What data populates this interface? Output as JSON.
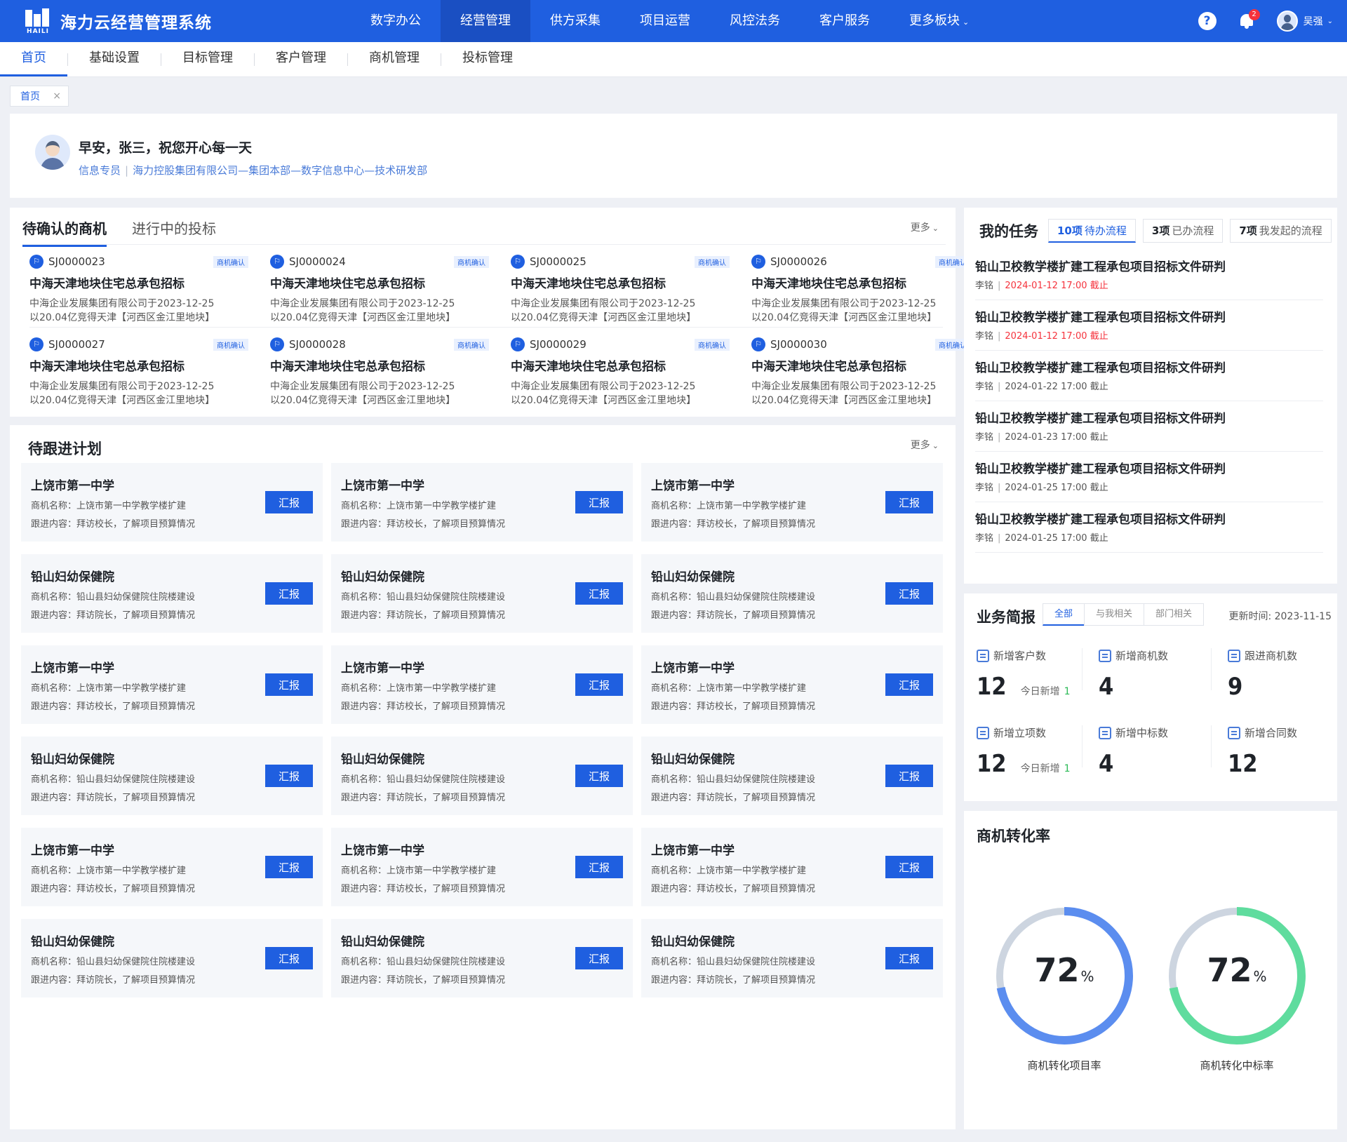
{
  "header": {
    "logo_text": "HAILI",
    "app_title": "海力云经营管理系统",
    "nav": [
      "数字办公",
      "经营管理",
      "供方采集",
      "项目运营",
      "风控法务",
      "客户服务",
      "更多板块"
    ],
    "nav_active": 1,
    "help_icon": "?",
    "notification_count": "2",
    "user_name": "吴强"
  },
  "subnav": {
    "items": [
      "首页",
      "基础设置",
      "目标管理",
      "客户管理",
      "商机管理",
      "投标管理"
    ],
    "active": 0
  },
  "page_tab": {
    "label": "首页",
    "close": "×"
  },
  "welcome": {
    "greeting": "早安，张三，祝您开心每一天",
    "role": "信息专员",
    "separator": "|",
    "org": "海力控股集团有限公司—集团本部—数字信息中心—技术研发部"
  },
  "opportunities": {
    "tabs": [
      "待确认的商机",
      "进行中的投标"
    ],
    "more": "更多",
    "items": [
      {
        "code": "SJ0000023",
        "badge": "商机确认",
        "title": "中海天津地块住宅总承包招标",
        "desc1": "中海企业发展集团有限公司于2023-12-25",
        "desc2": "以20.04亿竞得天津【河西区金江里地块】"
      },
      {
        "code": "SJ0000024",
        "badge": "商机确认",
        "title": "中海天津地块住宅总承包招标",
        "desc1": "中海企业发展集团有限公司于2023-12-25",
        "desc2": "以20.04亿竞得天津【河西区金江里地块】"
      },
      {
        "code": "SJ0000025",
        "badge": "商机确认",
        "title": "中海天津地块住宅总承包招标",
        "desc1": "中海企业发展集团有限公司于2023-12-25",
        "desc2": "以20.04亿竞得天津【河西区金江里地块】"
      },
      {
        "code": "SJ0000026",
        "badge": "商机确认",
        "title": "中海天津地块住宅总承包招标",
        "desc1": "中海企业发展集团有限公司于2023-12-25",
        "desc2": "以20.04亿竞得天津【河西区金江里地块】"
      },
      {
        "code": "SJ0000027",
        "badge": "商机确认",
        "title": "中海天津地块住宅总承包招标",
        "desc1": "中海企业发展集团有限公司于2023-12-25",
        "desc2": "以20.04亿竞得天津【河西区金江里地块】"
      },
      {
        "code": "SJ0000028",
        "badge": "商机确认",
        "title": "中海天津地块住宅总承包招标",
        "desc1": "中海企业发展集团有限公司于2023-12-25",
        "desc2": "以20.04亿竞得天津【河西区金江里地块】"
      },
      {
        "code": "SJ0000029",
        "badge": "商机确认",
        "title": "中海天津地块住宅总承包招标",
        "desc1": "中海企业发展集团有限公司于2023-12-25",
        "desc2": "以20.04亿竞得天津【河西区金江里地块】"
      },
      {
        "code": "SJ0000030",
        "badge": "商机确认",
        "title": "中海天津地块住宅总承包招标",
        "desc1": "中海企业发展集团有限公司于2023-12-25",
        "desc2": "以20.04亿竞得天津【河西区金江里地块】"
      }
    ]
  },
  "plans": {
    "title": "待跟进计划",
    "more": "更多",
    "button_label": "汇报",
    "items": [
      {
        "name": "上饶市第一中学",
        "opp": "商机名称：上饶市第一中学教学楼扩建",
        "content": "跟进内容：拜访校长，了解项目预算情况"
      },
      {
        "name": "上饶市第一中学",
        "opp": "商机名称：上饶市第一中学教学楼扩建",
        "content": "跟进内容：拜访校长，了解项目预算情况"
      },
      {
        "name": "上饶市第一中学",
        "opp": "商机名称：上饶市第一中学教学楼扩建",
        "content": "跟进内容：拜访校长，了解项目预算情况"
      },
      {
        "name": "铅山妇幼保健院",
        "opp": "商机名称：铅山县妇幼保健院住院楼建设",
        "content": "跟进内容：拜访院长，了解项目预算情况"
      },
      {
        "name": "铅山妇幼保健院",
        "opp": "商机名称：铅山县妇幼保健院住院楼建设",
        "content": "跟进内容：拜访院长，了解项目预算情况"
      },
      {
        "name": "铅山妇幼保健院",
        "opp": "商机名称：铅山县妇幼保健院住院楼建设",
        "content": "跟进内容：拜访院长，了解项目预算情况"
      },
      {
        "name": "上饶市第一中学",
        "opp": "商机名称：上饶市第一中学教学楼扩建",
        "content": "跟进内容：拜访校长，了解项目预算情况"
      },
      {
        "name": "上饶市第一中学",
        "opp": "商机名称：上饶市第一中学教学楼扩建",
        "content": "跟进内容：拜访校长，了解项目预算情况"
      },
      {
        "name": "上饶市第一中学",
        "opp": "商机名称：上饶市第一中学教学楼扩建",
        "content": "跟进内容：拜访校长，了解项目预算情况"
      },
      {
        "name": "铅山妇幼保健院",
        "opp": "商机名称：铅山县妇幼保健院住院楼建设",
        "content": "跟进内容：拜访院长，了解项目预算情况"
      },
      {
        "name": "铅山妇幼保健院",
        "opp": "商机名称：铅山县妇幼保健院住院楼建设",
        "content": "跟进内容：拜访院长，了解项目预算情况"
      },
      {
        "name": "铅山妇幼保健院",
        "opp": "商机名称：铅山县妇幼保健院住院楼建设",
        "content": "跟进内容：拜访院长，了解项目预算情况"
      },
      {
        "name": "上饶市第一中学",
        "opp": "商机名称：上饶市第一中学教学楼扩建",
        "content": "跟进内容：拜访校长，了解项目预算情况"
      },
      {
        "name": "上饶市第一中学",
        "opp": "商机名称：上饶市第一中学教学楼扩建",
        "content": "跟进内容：拜访校长，了解项目预算情况"
      },
      {
        "name": "上饶市第一中学",
        "opp": "商机名称：上饶市第一中学教学楼扩建",
        "content": "跟进内容：拜访校长，了解项目预算情况"
      },
      {
        "name": "铅山妇幼保健院",
        "opp": "商机名称：铅山县妇幼保健院住院楼建设",
        "content": "跟进内容：拜访院长，了解项目预算情况"
      },
      {
        "name": "铅山妇幼保健院",
        "opp": "商机名称：铅山县妇幼保健院住院楼建设",
        "content": "跟进内容：拜访院长，了解项目预算情况"
      },
      {
        "name": "铅山妇幼保健院",
        "opp": "商机名称：铅山县妇幼保健院住院楼建设",
        "content": "跟进内容：拜访院长，了解项目预算情况"
      }
    ]
  },
  "tasks": {
    "title": "我的任务",
    "tabs": [
      {
        "count": "10项",
        "label": "待办流程"
      },
      {
        "count": "3项",
        "label": "已办流程"
      },
      {
        "count": "7项",
        "label": "我发起的流程"
      }
    ],
    "items": [
      {
        "name": "铅山卫校教学楼扩建工程承包项目招标文件研判",
        "person": "李铭",
        "date": "2024-01-12  17:00",
        "suffix": "截止",
        "overdue": true
      },
      {
        "name": "铅山卫校教学楼扩建工程承包项目招标文件研判",
        "person": "李铭",
        "date": "2024-01-12  17:00",
        "suffix": "截止",
        "overdue": true
      },
      {
        "name": "铅山卫校教学楼扩建工程承包项目招标文件研判",
        "person": "李铭",
        "date": "2024-01-22  17:00",
        "suffix": "截止",
        "overdue": false
      },
      {
        "name": "铅山卫校教学楼扩建工程承包项目招标文件研判",
        "person": "李铭",
        "date": "2024-01-23 17:00",
        "suffix": "截止",
        "overdue": false
      },
      {
        "name": "铅山卫校教学楼扩建工程承包项目招标文件研判",
        "person": "李铭",
        "date": "2024-01-25 17:00",
        "suffix": "截止",
        "overdue": false
      },
      {
        "name": "铅山卫校教学楼扩建工程承包项目招标文件研判",
        "person": "李铭",
        "date": "2024-01-25 17:00",
        "suffix": "截止",
        "overdue": false
      }
    ]
  },
  "brief": {
    "title": "业务简报",
    "tabs": [
      "全部",
      "与我相关",
      "部门相关"
    ],
    "update_time": "更新时间: 2023-11-15",
    "stats": [
      {
        "label": "新增客户数",
        "value": "12",
        "today_label": "今日新增",
        "today_value": "1"
      },
      {
        "label": "新增商机数",
        "value": "4"
      },
      {
        "label": "跟进商机数",
        "value": "9"
      },
      {
        "label": "新增立项数",
        "value": "12",
        "today_label": "今日新增",
        "today_value": "1"
      },
      {
        "label": "新增中标数",
        "value": "4"
      },
      {
        "label": "新增合同数",
        "value": "12"
      }
    ]
  },
  "rate": {
    "title": "商机转化率",
    "gauges": [
      {
        "value": "72",
        "unit": "%",
        "fraction": 0.72,
        "label": "商机转化项目率",
        "color": "#5b8def"
      },
      {
        "value": "72",
        "unit": "%",
        "fraction": 0.72,
        "label": "商机转化中标率",
        "color": "#5fdc9e"
      }
    ],
    "track_color": "#cdd5e0"
  }
}
